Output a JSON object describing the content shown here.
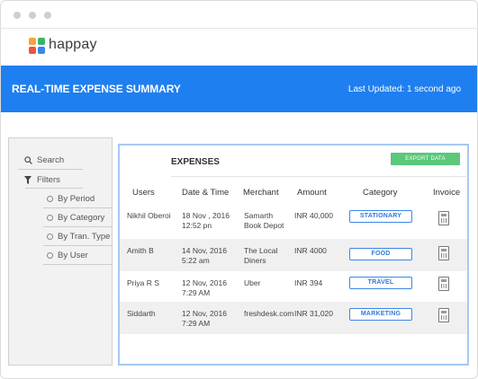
{
  "app": {
    "logo_text": "happay"
  },
  "banner": {
    "title": "REAL-TIME EXPENSE SUMMARY",
    "updated": "Last Updated: 1 second ago"
  },
  "sidebar": {
    "search": "Search",
    "filters": "Filters",
    "items": [
      {
        "label": "By Period"
      },
      {
        "label": "By Category"
      },
      {
        "label": "By Tran. Type"
      },
      {
        "label": "By User"
      }
    ]
  },
  "expenses": {
    "title": "EXPENSES",
    "export_label": "EXPORT DATA",
    "headers": [
      "Users",
      "Date & Time",
      "Merchant",
      "Amount",
      "Category",
      "Invoice"
    ],
    "rows": [
      {
        "user": "Nikhil Oberoi",
        "date": "18 Nov , 2016",
        "time": "12:52 pn",
        "merchant_1": "Samarth",
        "merchant_2": "Book Depot",
        "amount": "INR 40,000",
        "category": "STATIONARY"
      },
      {
        "user": "Amith B",
        "date": "14 Nov, 2016",
        "time": "5:22 am",
        "merchant_1": "The Local",
        "merchant_2": "Diners",
        "amount": "INR 4000",
        "category": "FOOD"
      },
      {
        "user": "Priya R S",
        "date": "12 Nov, 2016",
        "time": "7:29 AM",
        "merchant_1": "Uber",
        "merchant_2": "",
        "amount": "INR 394",
        "category": "TRAVEL"
      },
      {
        "user": "Siddarth",
        "date": "12 Nov, 2016",
        "time": "7:29 AM",
        "merchant_1": "freshdesk.com",
        "merchant_2": "",
        "amount": "INR 31,020",
        "category": "MARKETING"
      }
    ]
  },
  "colors": {
    "brand_blue": "#1e7ff0",
    "export_green": "#5bc87a",
    "category_blue": "#3b86e8"
  },
  "icons": [
    "search-icon",
    "filter-icon",
    "invoice-icon"
  ]
}
